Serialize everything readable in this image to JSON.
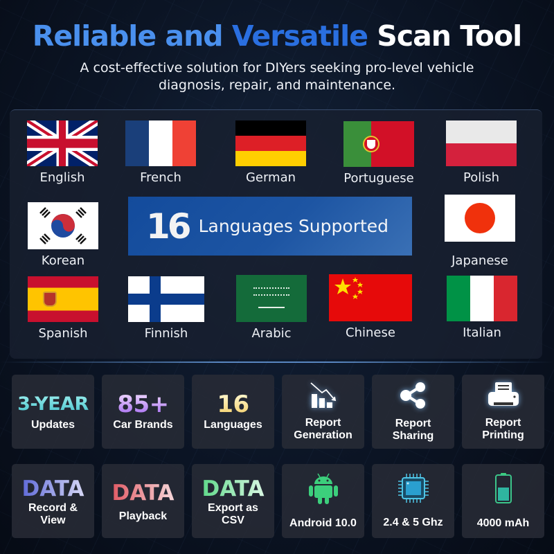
{
  "header": {
    "title_part1": "Reliable and ",
    "title_part2": "Versatile",
    "title_part3": " Scan Tool",
    "subtitle_line1": "A cost-effective solution for DIYers seeking pro-level vehicle",
    "subtitle_line2": "diagnosis, repair, and maintenance."
  },
  "languages": {
    "banner_number": "16",
    "banner_text": "Languages Supported",
    "items": [
      {
        "label": "English",
        "icon": "uk-flag-icon"
      },
      {
        "label": "French",
        "icon": "france-flag-icon"
      },
      {
        "label": "German",
        "icon": "germany-flag-icon"
      },
      {
        "label": "Portuguese",
        "icon": "portugal-flag-icon"
      },
      {
        "label": "Polish",
        "icon": "poland-flag-icon"
      },
      {
        "label": "Korean",
        "icon": "korea-flag-icon"
      },
      {
        "label": "Japanese",
        "icon": "japan-flag-icon"
      },
      {
        "label": "Spanish",
        "icon": "spain-flag-icon"
      },
      {
        "label": "Finnish",
        "icon": "finland-flag-icon"
      },
      {
        "label": "Arabic",
        "icon": "saudi-flag-icon"
      },
      {
        "label": "Chinese",
        "icon": "china-flag-icon"
      },
      {
        "label": "Italian",
        "icon": "italy-flag-icon"
      }
    ]
  },
  "features_row1": [
    {
      "big": "3-YEAR",
      "sub": "Updates"
    },
    {
      "big": "85+",
      "sub": "Car Brands"
    },
    {
      "big": "16",
      "sub": "Languages"
    },
    {
      "sub_line1": "Report",
      "sub_line2": "Generation",
      "icon": "report-chart-icon"
    },
    {
      "sub_line1": "Report",
      "sub_line2": "Sharing",
      "icon": "share-icon"
    },
    {
      "sub_line1": "Report",
      "sub_line2": "Printing",
      "icon": "printer-icon"
    }
  ],
  "features_row2": [
    {
      "big": "DATA",
      "sub_line1": "Record &",
      "sub_line2": "View"
    },
    {
      "big": "DATA",
      "sub_line1": "Playback"
    },
    {
      "big": "DATA",
      "sub_line1": "Export as",
      "sub_line2": "CSV"
    },
    {
      "sub_line1": "Android 10.0",
      "icon": "android-icon"
    },
    {
      "sub_line1": "2.4 & 5 Ghz",
      "icon": "chip-icon"
    },
    {
      "sub_line1": "4000 mAh",
      "icon": "battery-icon"
    }
  ],
  "colors": {
    "title_blue": "#4a90ee",
    "title_blue_dark": "#2a6fe0",
    "banner_blue": "#1d55a3"
  }
}
